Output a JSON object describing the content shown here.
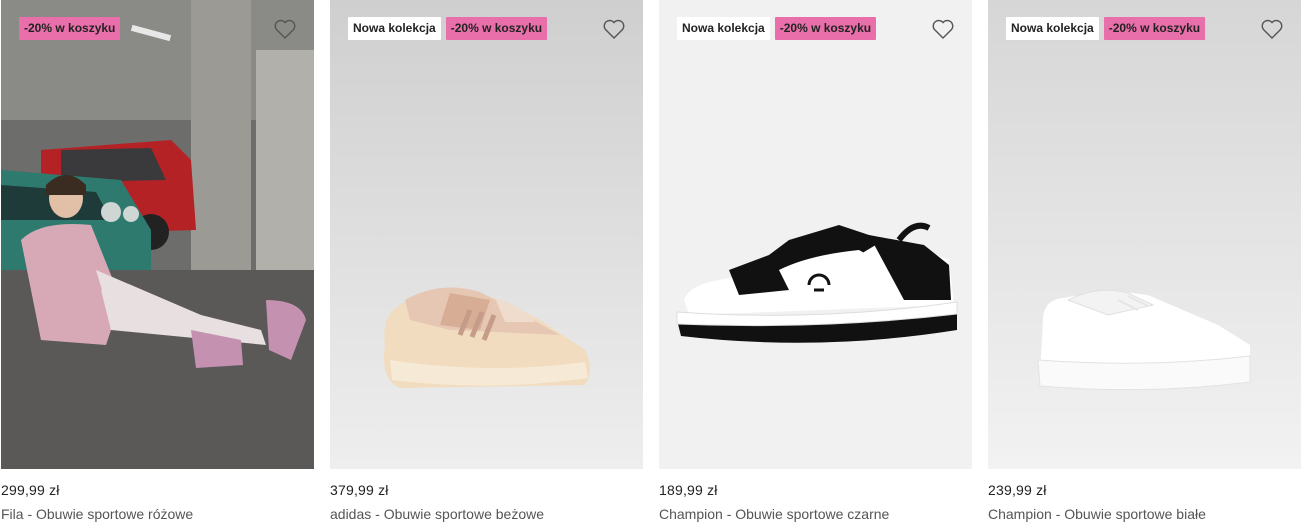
{
  "products": [
    {
      "badges": {
        "promo": "-20% w koszyku"
      },
      "price": "299,99 zł",
      "name": "Fila - Obuwie sportowe różowe",
      "image": "lifestyle-photo-pink-sneakers"
    },
    {
      "badges": {
        "new": "Nowa kolekcja",
        "promo": "-20% w koszyku"
      },
      "price": "379,99 zł",
      "name": "adidas - Obuwie sportowe beżowe",
      "image": "beige-sneaker"
    },
    {
      "badges": {
        "new": "Nowa kolekcja",
        "promo": "-20% w koszyku"
      },
      "price": "189,99 zł",
      "name": "Champion - Obuwie sportowe czarne",
      "image": "black-white-sneaker"
    },
    {
      "badges": {
        "new": "Nowa kolekcja",
        "promo": "-20% w koszyku"
      },
      "price": "239,99 zł",
      "name": "Champion - Obuwie sportowe białe",
      "image": "white-sneaker"
    }
  ],
  "colors": {
    "promo_badge": "#e86fa9",
    "image_bg": "#e8e8e8"
  },
  "icons": {
    "favorite": "heart-outline-icon"
  }
}
